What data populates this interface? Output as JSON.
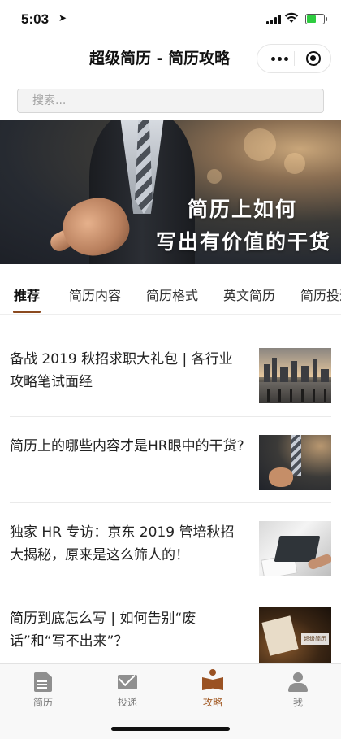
{
  "status_bar": {
    "time": "5:03",
    "location_icon": "location-arrow-icon",
    "signal_icon": "cellular-signal-icon",
    "wifi_icon": "wifi-icon",
    "battery_icon": "battery-icon"
  },
  "nav": {
    "title": "超级简历 - 简历攻略",
    "more_icon": "more-dots-icon",
    "close_icon": "miniprogram-close-icon"
  },
  "search": {
    "placeholder": "搜索..."
  },
  "banner": {
    "line1": "简历上如何",
    "line2": "写出有价值的干货"
  },
  "tabs": [
    {
      "label": "推荐",
      "active": true
    },
    {
      "label": "简历内容",
      "active": false
    },
    {
      "label": "简历格式",
      "active": false
    },
    {
      "label": "英文简历",
      "active": false
    },
    {
      "label": "简历投递",
      "active": false
    }
  ],
  "articles": [
    {
      "title": "备战 2019 秋招求职大礼包 | 各行业攻略笔试面经",
      "thumbnail": "city-skyline-thumbnail"
    },
    {
      "title": "简历上的哪些内容才是HR眼中的干货?",
      "thumbnail": "businessman-pointing-thumbnail"
    },
    {
      "title": "独家 HR 专访：京东 2019 管培秋招大揭秘，原来是这么筛人的！",
      "thumbnail": "office-desk-thumbnail"
    },
    {
      "title": "简历到底怎么写 | 如何告别“废话”和“写不出来”？",
      "thumbnail": "resume-brand-thumbnail",
      "thumb_logo": "超级简历"
    }
  ],
  "tab_bar": [
    {
      "label": "简历",
      "icon": "document-icon",
      "active": false
    },
    {
      "label": "投递",
      "icon": "mail-icon",
      "active": false
    },
    {
      "label": "攻略",
      "icon": "book-icon",
      "active": true
    },
    {
      "label": "我",
      "icon": "person-icon",
      "active": false
    }
  ],
  "colors": {
    "accent": "#a0561f",
    "inactive": "#8f8f8f",
    "tab_underline": "#8b4a1f"
  }
}
